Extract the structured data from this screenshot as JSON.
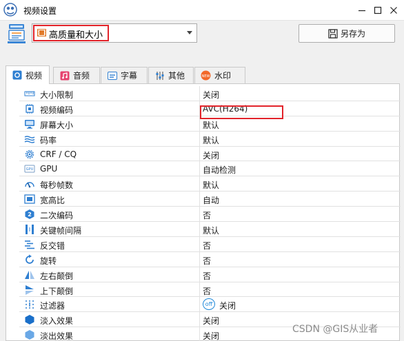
{
  "window": {
    "title": "视频设置"
  },
  "preset": {
    "selected": "高质量和大小",
    "save_as_label": "另存为"
  },
  "tabs": [
    {
      "label": "视频",
      "icon": "video-settings-icon"
    },
    {
      "label": "音频",
      "icon": "music-note-icon"
    },
    {
      "label": "字幕",
      "icon": "subtitle-icon"
    },
    {
      "label": "其他",
      "icon": "sliders-icon"
    },
    {
      "label": "水印",
      "icon": "new-badge-icon"
    }
  ],
  "settings": [
    {
      "name": "大小限制",
      "value": "关闭",
      "icon": "ruler-icon"
    },
    {
      "name": "视频编码",
      "value": "AVC(H264)",
      "icon": "chip-icon"
    },
    {
      "name": "屏幕大小",
      "value": "默认",
      "icon": "monitor-icon"
    },
    {
      "name": "码率",
      "value": "默认",
      "icon": "waves-icon"
    },
    {
      "name": "CRF / CQ",
      "value": "关闭",
      "icon": "gear-icon"
    },
    {
      "name": "GPU",
      "value": "自动检测",
      "icon": "gpu-icon"
    },
    {
      "name": "每秒帧数",
      "value": "默认",
      "icon": "speedometer-icon"
    },
    {
      "name": "宽高比",
      "value": "自动",
      "icon": "aspect-ratio-icon"
    },
    {
      "name": "二次编码",
      "value": "否",
      "icon": "two-pass-icon"
    },
    {
      "name": "关键帧间隔",
      "value": "默认",
      "icon": "keyframe-icon"
    },
    {
      "name": "反交错",
      "value": "否",
      "icon": "deinterlace-icon"
    },
    {
      "name": "旋转",
      "value": "否",
      "icon": "rotate-icon"
    },
    {
      "name": "左右颠倒",
      "value": "否",
      "icon": "flip-horizontal-icon"
    },
    {
      "name": "上下颠倒",
      "value": "否",
      "icon": "flip-vertical-icon"
    },
    {
      "name": "过滤器",
      "value": "关闭",
      "icon": "filter-icon",
      "chip": "off"
    },
    {
      "name": "淡入效果",
      "value": "关闭",
      "icon": "fade-in-icon"
    },
    {
      "name": "淡出效果",
      "value": "关闭",
      "icon": "fade-out-icon"
    }
  ],
  "watermark": "CSDN @GIS从业者",
  "colors": {
    "accent": "#1b86d8",
    "highlight": "#e2232a"
  }
}
